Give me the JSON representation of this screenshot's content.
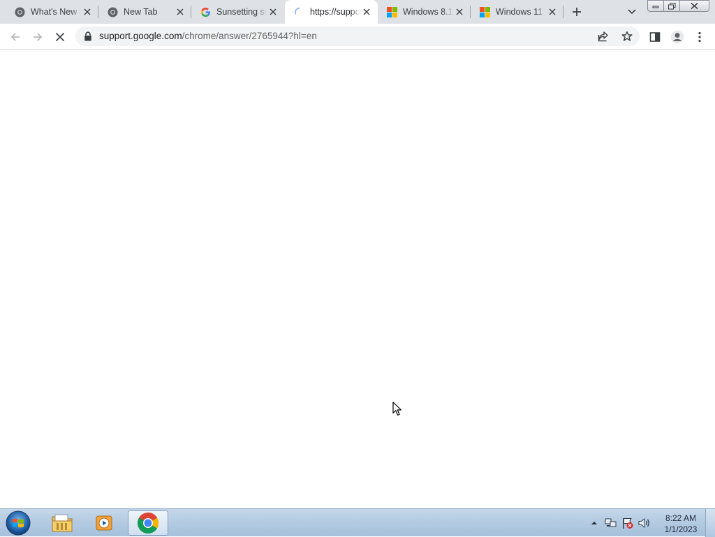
{
  "tabs": [
    {
      "title": "What's New",
      "icon": "chrome-icon",
      "active": false
    },
    {
      "title": "New Tab",
      "icon": "chrome-icon",
      "active": false
    },
    {
      "title": "Sunsetting support",
      "icon": "google-g-icon",
      "active": false
    },
    {
      "title": "https://support.google.com",
      "icon": "loading-spinner-icon",
      "active": true
    },
    {
      "title": "Windows 8.1",
      "icon": "windows-logo-icon",
      "active": false
    },
    {
      "title": "Windows 11",
      "icon": "windows-logo-icon",
      "active": false
    }
  ],
  "omnibox": {
    "host": "support.google.com",
    "path": "/chrome/answer/2765944?hl=en"
  },
  "taskbar": {
    "apps": [
      "windows-explorer-icon",
      "media-player-icon",
      "chrome-icon"
    ],
    "active_app": "chrome-icon"
  },
  "clock": {
    "time": "8:22 AM",
    "date": "1/1/2023"
  },
  "colors": {
    "tabstrip": "#dee1e6",
    "omnibox": "#f1f3f4",
    "taskbar": "#b4cbe2"
  }
}
